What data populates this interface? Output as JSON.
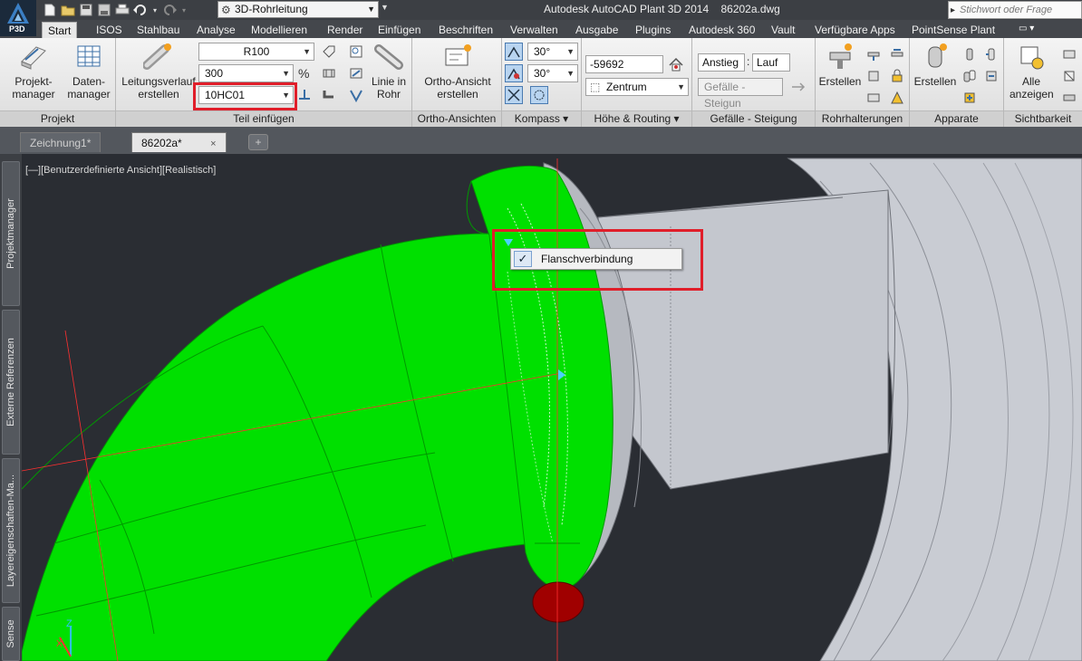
{
  "app": {
    "logo_text": "P3D",
    "title": "Autodesk AutoCAD Plant 3D 2014",
    "filename": "86202a.dwg",
    "workspace": "3D-Rohrleitung",
    "search_placeholder": "Stichwort oder Frage eingeben"
  },
  "ribbon_tabs": [
    "Start",
    "ISOS",
    "Stahlbau",
    "Analyse",
    "Modellieren",
    "Render",
    "Einfügen",
    "Beschriften",
    "Verwalten",
    "Ausgabe",
    "Plugins",
    "Autodesk 360",
    "Vault",
    "Verfügbare Apps",
    "PointSense Plant"
  ],
  "panels": {
    "projekt": {
      "title": "Projekt",
      "projektmanager_label": "Projekt-\nmanager",
      "datenmanager_label": "Daten-\nmanager"
    },
    "teil_einfuegen": {
      "title": "Teil einfügen",
      "leitungsverlauf_label": "Leitungsverlauf\nerstellen",
      "spec_value": "R100",
      "size_value": "300",
      "service_value": "10HC01",
      "linie_in_rohr_label": "Linie in\nRohr"
    },
    "ortho": {
      "title": "Ortho-Ansichten",
      "ortho_label": "Ortho-Ansicht\nerstellen"
    },
    "kompass": {
      "title": "Kompass",
      "angle1": "30°",
      "angle2": "30°"
    },
    "hoehe": {
      "title": "Höhe & Routing",
      "elevation_value": "-59692",
      "justify_value": "Zentrum"
    },
    "gefaelle": {
      "title": "Gefälle - Steigung",
      "anstieg": "Anstieg",
      "separator": ":",
      "lauf": "Lauf",
      "gefaelle_btn": "Gefälle - Steigun"
    },
    "rohrhalterungen": {
      "title": "Rohrhalterungen",
      "erstellen_label": "Erstellen"
    },
    "apparate": {
      "title": "Apparate",
      "erstellen_label": "Erstellen"
    },
    "sichtbarkeit": {
      "title": "Sichtbarkeit",
      "alle_label": "Alle\nanzeigen"
    }
  },
  "doc_tabs": [
    {
      "label": "Zeichnung1*"
    },
    {
      "label": "86202a*",
      "close": "×"
    }
  ],
  "side_palettes": [
    "Projektmanager",
    "Externe Referenzen",
    "Layereigenschaften-Ma...",
    "Sense"
  ],
  "viewport": {
    "label": "[—][Benutzerdefinierte Ansicht][Realistisch]"
  },
  "context_popup": {
    "check": "✓",
    "label": "Flanschverbindung"
  },
  "colors": {
    "pipe_green": "#00e000",
    "pipe_edge": "#009900",
    "equipment_gray": "#c9ccd3",
    "highlight_red": "#e01e2a",
    "viewport_bg": "#2a2d33"
  }
}
